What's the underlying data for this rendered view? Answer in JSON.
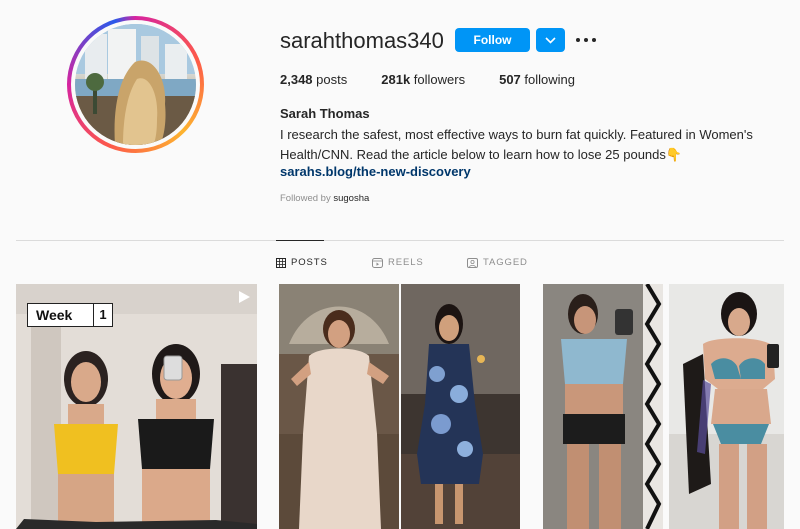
{
  "profile": {
    "username": "sarahthomas340",
    "follow_label": "Follow",
    "stats": {
      "posts_count": "2,348",
      "posts_label": "posts",
      "followers_count": "281k",
      "followers_label": "followers",
      "following_count": "507",
      "following_label": "following"
    },
    "full_name": "Sarah Thomas",
    "bio_line1": "I research the safest, most effective ways to burn fat quickly. Featured in Women's",
    "bio_line2": "Health/CNN. Read the article below to learn how to lose 25 pounds👇",
    "link": "sarahs.blog/the-new-discovery",
    "followed_by_prefix": "Followed by ",
    "followed_by_user": "sugosha"
  },
  "tabs": [
    {
      "label": "POSTS",
      "icon": "grid-icon",
      "active": true
    },
    {
      "label": "REELS",
      "icon": "reels-icon",
      "active": false
    },
    {
      "label": "TAGGED",
      "icon": "tagged-icon",
      "active": false
    }
  ],
  "posts": [
    {
      "overlay_week": "Week",
      "overlay_number": "1",
      "type": "reel"
    },
    {
      "type": "photo"
    },
    {
      "type": "photo"
    }
  ],
  "colors": {
    "accent": "#0095f6",
    "link": "#00376b",
    "muted": "#8e8e8e",
    "text": "#262626"
  }
}
